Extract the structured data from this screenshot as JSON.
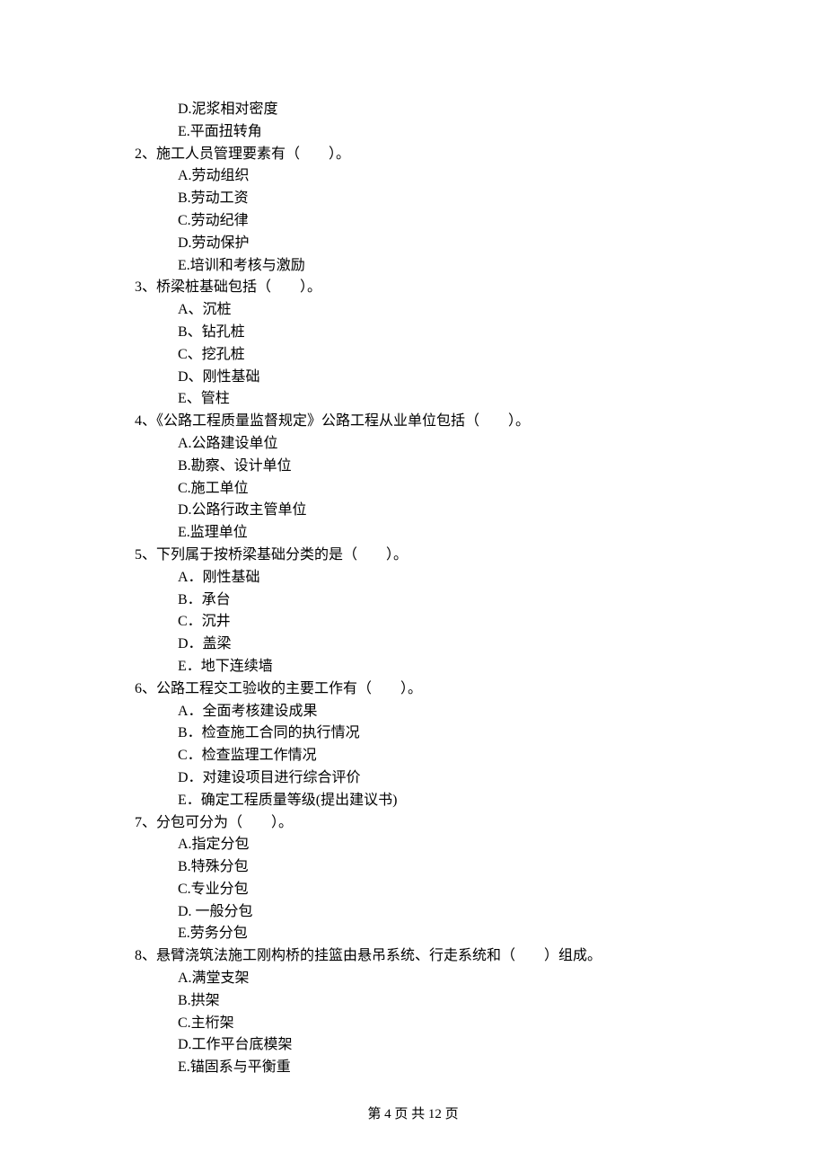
{
  "pre_options": {
    "d": "D.泥浆相对密度",
    "e": "E.平面扭转角"
  },
  "q2": {
    "stem": "2、施工人员管理要素有（　　）。",
    "a": "A.劳动组织",
    "b": "B.劳动工资",
    "c": "C.劳动纪律",
    "d": "D.劳动保护",
    "e": "E.培训和考核与激励"
  },
  "q3": {
    "stem": "3、桥梁桩基础包括（　　）。",
    "a": "A、沉桩",
    "b": "B、钻孔桩",
    "c": "C、挖孔桩",
    "d": "D、刚性基础",
    "e": "E、管柱"
  },
  "q4": {
    "stem": "4、《公路工程质量监督规定》公路工程从业单位包括（　　）。",
    "a": "A.公路建设单位",
    "b": "B.勘察、设计单位",
    "c": "C.施工单位",
    "d": "D.公路行政主管单位",
    "e": "E.监理单位"
  },
  "q5": {
    "stem": "5、下列属于按桥梁基础分类的是（　　）。",
    "a": "A．刚性基础",
    "b": "B．承台",
    "c": "C．沉井",
    "d": "D．盖梁",
    "e": "E．地下连续墙"
  },
  "q6": {
    "stem": "6、公路工程交工验收的主要工作有（　　）。",
    "a": "A．全面考核建设成果",
    "b": "B．检查施工合同的执行情况",
    "c": "C．检查监理工作情况",
    "d": "D．对建设项目进行综合评价",
    "e": "E．确定工程质量等级(提出建议书)"
  },
  "q7": {
    "stem": "7、分包可分为（　　）。",
    "a": "A.指定分包",
    "b": "B.特殊分包",
    "c": "C.专业分包",
    "d": "D. 一般分包",
    "e": "E.劳务分包"
  },
  "q8": {
    "stem": "8、悬臂浇筑法施工刚构桥的挂篮由悬吊系统、行走系统和（　　）组成。",
    "a": "A.满堂支架",
    "b": "B.拱架",
    "c": "C.主桁架",
    "d": "D.工作平台底模架",
    "e": "E.锚固系与平衡重"
  },
  "footer": "第 4 页 共 12 页"
}
